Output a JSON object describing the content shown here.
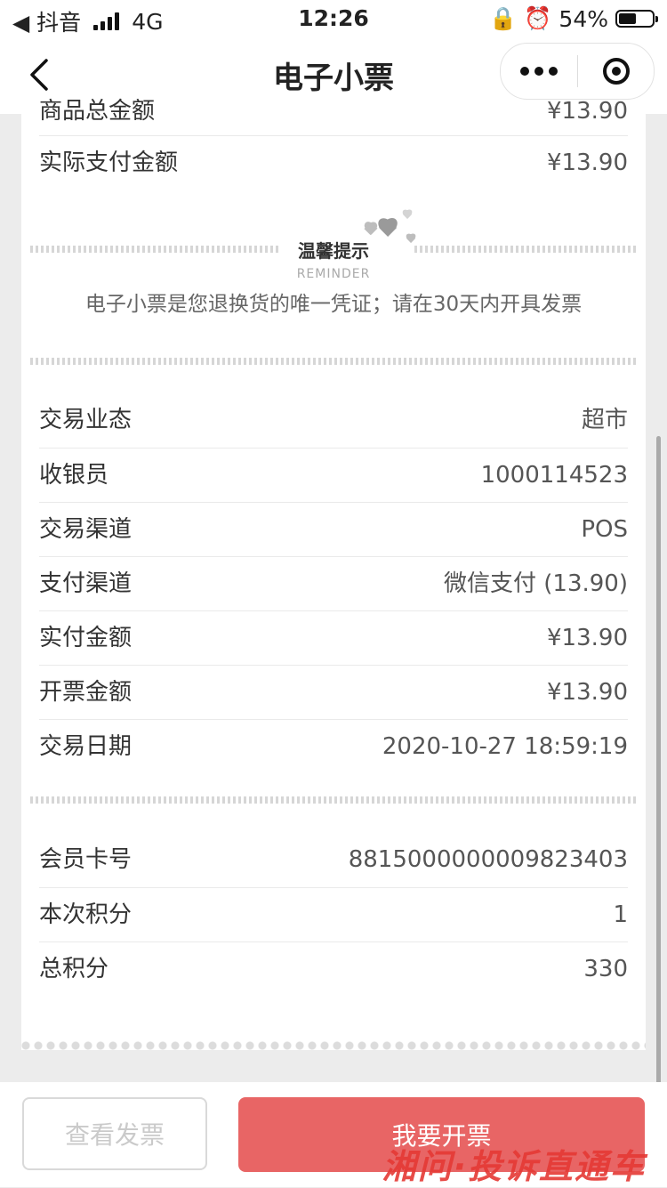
{
  "status_bar": {
    "back_app": "◀ 抖音",
    "network": "4G",
    "time": "12:26",
    "battery_percent": "54%",
    "battery_level": 0.54
  },
  "nav": {
    "title": "电子小票"
  },
  "top_rows": [
    {
      "label": "商品总金额",
      "value": "¥13.90"
    },
    {
      "label": "实际支付金额",
      "value": "¥13.90"
    }
  ],
  "reminder": {
    "title": "温馨提示",
    "subtitle": "REMINDER",
    "text": "电子小票是您退换货的唯一凭证；请在30天内开具发票"
  },
  "transaction_rows": [
    {
      "label": "交易业态",
      "value": "超市"
    },
    {
      "label": "收银员",
      "value": "1000114523"
    },
    {
      "label": "交易渠道",
      "value": "POS"
    },
    {
      "label": "支付渠道",
      "value": "微信支付 (13.90)"
    },
    {
      "label": "实付金额",
      "value": "¥13.90"
    },
    {
      "label": "开票金额",
      "value": "¥13.90"
    },
    {
      "label": "交易日期",
      "value": "2020-10-27 18:59:19"
    }
  ],
  "member_rows": [
    {
      "label": "会员卡号",
      "value": "8815000000009823403"
    },
    {
      "label": "本次积分",
      "value": "1"
    },
    {
      "label": "总积分",
      "value": "330"
    }
  ],
  "actions": {
    "view_invoice": "查看发票",
    "request_invoice": "我要开票"
  },
  "watermark": "湘问·投诉直通车",
  "colors": {
    "primary_button": "#e86565",
    "watermark": "#e53935"
  }
}
